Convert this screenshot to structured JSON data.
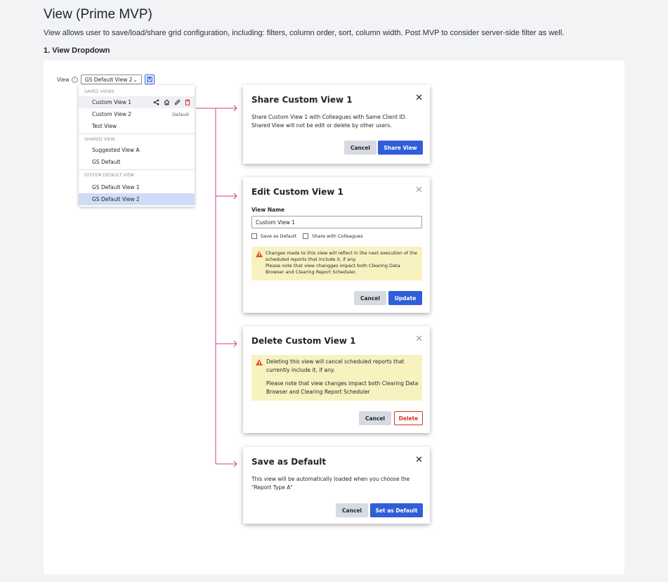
{
  "page": {
    "title": "View (Prime MVP)",
    "description": "View allows user to save/load/share grid configuration, including: filters, column order, sort, column width. Post MVP to consider server-side filter as well.",
    "section_title": "1. View Dropdown"
  },
  "view_selector": {
    "label": "View",
    "info_icon": "info-circle-icon",
    "selected_value": "GS Default View 2",
    "save_icon": "floppy-disk-icon"
  },
  "dropdown": {
    "saved_views_label": "SAVED VIEWS",
    "saved_views": [
      {
        "label": "Custom View 1",
        "state": "hover"
      },
      {
        "label": "Custom View 2",
        "tag": "Default"
      },
      {
        "label": "Test View"
      }
    ],
    "item_action_icons": [
      "share-icon",
      "home-icon",
      "pencil-icon",
      "trash-icon"
    ],
    "shared_view_label": "SHARED VIEW",
    "shared_views": [
      {
        "label": "Suggested View A"
      },
      {
        "label": "GS Default"
      }
    ],
    "system_default_label": "SYSTEM DEFAULT VIEW",
    "system_views": [
      {
        "label": "GS Default View 1"
      },
      {
        "label": "GS Default View 2",
        "state": "selected"
      }
    ]
  },
  "share_modal": {
    "title": "Share Custom View 1",
    "body": "Share Custom View 1 with Colleagues with Same Client ID. Shared View will not be edit or delete by other users.",
    "cancel_label": "Cancel",
    "confirm_label": "Share View"
  },
  "edit_modal": {
    "title": "Edit Custom View 1",
    "field_label": "View Name",
    "field_value": "Custom View 1",
    "check_default_label": "Save as Default",
    "check_share_label": "Share with Colleagues",
    "warning_line1": "Changes made to this view will reflect in the next execution of the scheduled reports that include it, if any.",
    "warning_line2": "Please note that view changges impact both Clearing Data Browser and Clearing Report Scheduler.",
    "cancel_label": "Cancel",
    "confirm_label": "Update"
  },
  "delete_modal": {
    "title": "Delete Custom View 1",
    "warning_line1": "Deleting this view will cancel scheduled reports that currently include it, if any.",
    "warning_line2": "Please note that view changes impact both Clearing Data Browser and Clearing Report Scheduler",
    "cancel_label": "Cancel",
    "confirm_label": "Delete"
  },
  "default_modal": {
    "title": "Save as Default",
    "body": "This view will be automatically loaded when you choose the \"Report Type A\"",
    "cancel_label": "Cancel",
    "confirm_label": "Set as Default"
  },
  "colors": {
    "primary": "#2f5ed8",
    "danger": "#d93025",
    "connector": "#d63b8f",
    "warning_bg": "#f7f2c0",
    "warning_icon": "#e4571e",
    "selected_bg": "#cfdcf7"
  }
}
